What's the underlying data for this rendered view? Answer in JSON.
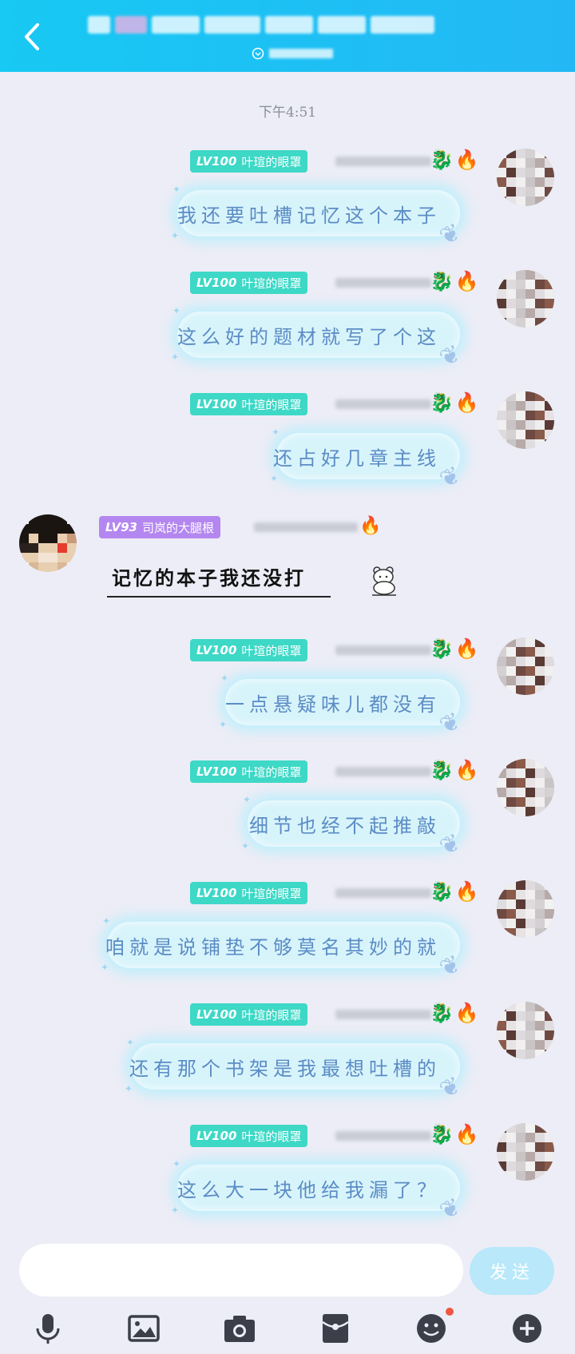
{
  "header": {
    "title": "",
    "subtitle": ""
  },
  "timestamp": "下午4:51",
  "me": {
    "level": "LV100",
    "name": "叶瑄的眼罩",
    "badge_color": "#3dd8c6"
  },
  "other": {
    "level": "LV93",
    "name": "司岚的大腿根",
    "badge_color": "#b487f0"
  },
  "messages": [
    {
      "side": "right",
      "text": "我还要吐槽记忆这个本子"
    },
    {
      "side": "right",
      "text": "这么好的题材就写了个这"
    },
    {
      "side": "right",
      "text": "还占好几章主线"
    },
    {
      "side": "left",
      "text": "记忆的本子我还没打"
    },
    {
      "side": "right",
      "text": "一点悬疑味儿都没有"
    },
    {
      "side": "right",
      "text": "细节也经不起推敲"
    },
    {
      "side": "right",
      "text": "咱就是说铺垫不够莫名其妙的就"
    },
    {
      "side": "right",
      "text": "还有那个书架是我最想吐槽的"
    },
    {
      "side": "right",
      "text": "这么大一块他给我漏了？"
    }
  ],
  "input": {
    "value": "",
    "send_label": "发送"
  },
  "toolbar": [
    "microphone-icon",
    "image-icon",
    "camera-icon",
    "red-packet-icon",
    "emoji-icon",
    "plus-icon"
  ],
  "colors": {
    "header": "#17c9f3",
    "bubble": "#d8f4fb",
    "bubble_text": "#5b8cc5",
    "notification_dot": "#f0553f"
  }
}
